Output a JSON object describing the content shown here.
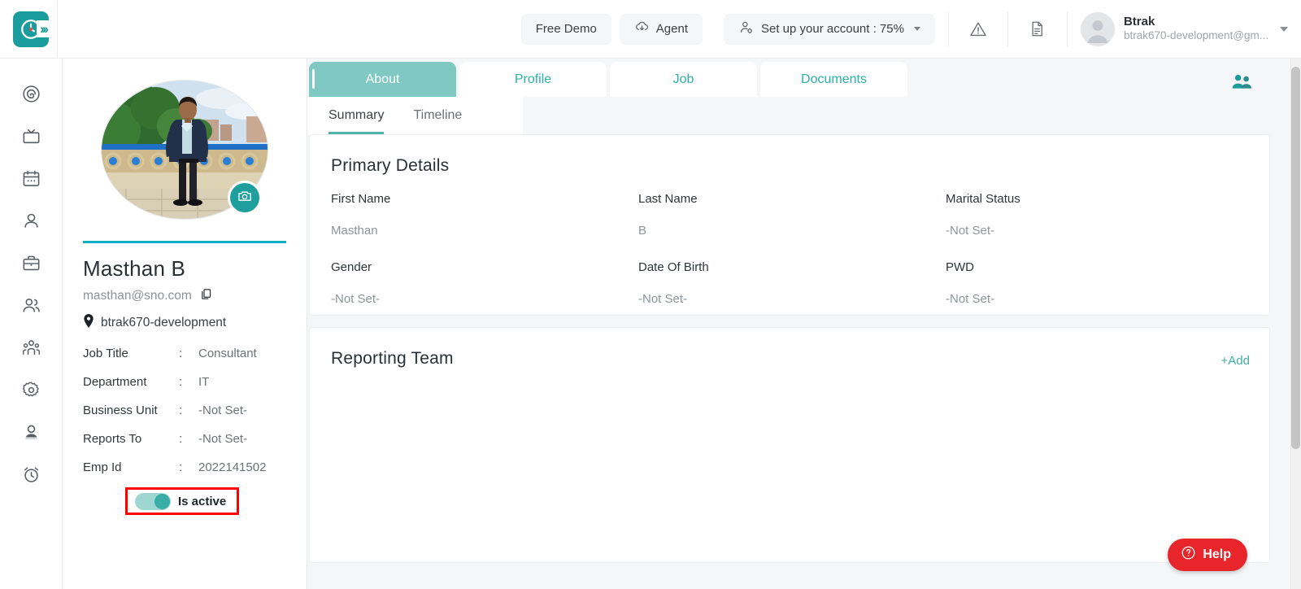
{
  "topbar": {
    "logo_icon": "clock-logo-icon",
    "expand_icon": "chevron-double-right-icon",
    "free_demo_label": "Free Demo",
    "agent_label": "Agent",
    "agent_icon": "cloud-download-icon",
    "setup_label": "Set up your account : 75%",
    "setup_icon": "user-gear-icon",
    "setup_caret_icon": "caret-down-icon",
    "warning_icon": "warning-triangle-icon",
    "document_icon": "document-icon",
    "avatar_icon": "user-avatar-icon",
    "user_name": "Btrak",
    "user_email": "btrak670-development@gm...",
    "user_caret_icon": "caret-down-icon"
  },
  "rail": {
    "items": [
      {
        "icon": "spiral-dashboard-icon",
        "name": "dashboard"
      },
      {
        "icon": "tv-icon",
        "name": "screens"
      },
      {
        "icon": "calendar-icon",
        "name": "calendar"
      },
      {
        "icon": "user-icon",
        "name": "employee"
      },
      {
        "icon": "briefcase-icon",
        "name": "jobs"
      },
      {
        "icon": "two-users-icon",
        "name": "teams"
      },
      {
        "icon": "group-people-icon",
        "name": "org"
      },
      {
        "icon": "gear-icon",
        "name": "settings"
      },
      {
        "icon": "person-badge-icon",
        "name": "profile"
      },
      {
        "icon": "alarm-clock-icon",
        "name": "timesheet"
      }
    ]
  },
  "profile": {
    "photo_alt": "employee-photo",
    "camera_icon": "camera-icon",
    "name": "Masthan B",
    "email": "masthan@sno.com",
    "copy_icon": "copy-icon",
    "location_icon": "location-pin-icon",
    "location": "btrak670-development",
    "fields": [
      {
        "label": "Job Title",
        "sep": ":",
        "value": "Consultant"
      },
      {
        "label": "Department",
        "sep": ":",
        "value": "IT"
      },
      {
        "label": "Business Unit",
        "sep": ":",
        "value": "-Not Set-"
      },
      {
        "label": "Reports To",
        "sep": ":",
        "value": "-Not Set-"
      },
      {
        "label": "Emp Id",
        "sep": ":",
        "value": "2022141502"
      }
    ],
    "toggle": {
      "label": "Is active",
      "state": "on",
      "highlight_color": "#ff0000"
    }
  },
  "main": {
    "tabs": [
      {
        "label": "About",
        "active": true
      },
      {
        "label": "Profile",
        "active": false
      },
      {
        "label": "Job",
        "active": false
      },
      {
        "label": "Documents",
        "active": false
      }
    ],
    "people_icon": "two-people-icon",
    "subtabs": [
      {
        "label": "Summary",
        "active": true
      },
      {
        "label": "Timeline",
        "active": false
      }
    ],
    "primary_details": {
      "title": "Primary Details",
      "fields": [
        {
          "label": "First Name",
          "value": "Masthan"
        },
        {
          "label": "Last Name",
          "value": "B"
        },
        {
          "label": "Marital Status",
          "value": "-Not Set-"
        },
        {
          "label": "Gender",
          "value": "-Not Set-"
        },
        {
          "label": "Date Of Birth",
          "value": "-Not Set-"
        },
        {
          "label": "PWD",
          "value": "-Not Set-"
        }
      ]
    },
    "reporting_team": {
      "title": "Reporting Team",
      "add_label": "+Add"
    }
  },
  "help": {
    "label": "Help",
    "icon": "question-circle-icon",
    "color": "#e8252a"
  },
  "colors": {
    "brand_teal": "#1b9c9c",
    "tab_active": "#7fc9c2",
    "tab_text": "#2cb0a6",
    "accent_rule": "#12aec1",
    "help_red": "#e8252a",
    "highlight_red": "#ff0000"
  }
}
